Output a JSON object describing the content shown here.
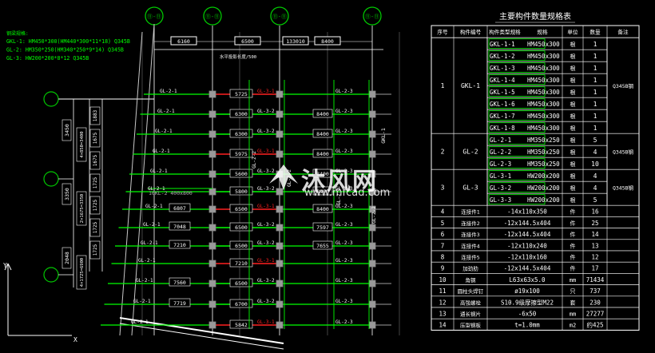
{
  "colors": {
    "background": "#000000",
    "cad_green": "#00ff00",
    "cad_white": "#ffffff",
    "cad_yellow": "#ffff00",
    "cad_red": "#ff2020",
    "cad_cyan": "#00ffff",
    "axis_green": "#00c800"
  },
  "axis_bubbles_top": [
    "⑪-⑪",
    "⑪-⑪",
    "⑪-⑪",
    "⑪-⑪"
  ],
  "dims_top": [
    "6160",
    "6500",
    "133010",
    "8400"
  ],
  "legend": {
    "heading": "钢梁规格:",
    "lines": [
      "GKL-1: HM450*300(HM440*300*11*18)    Q345B",
      "GL-2: HM350*250(HM340*250*9*14)   Q345B",
      "GL-3: HW200*200*8*12    Q345B"
    ]
  },
  "row_dims": [
    "5725",
    "6300",
    "6300",
    "5975",
    "5600",
    "5800",
    "6500",
    "6500",
    "6500",
    "7210",
    "6500",
    "6700",
    "5842"
  ],
  "right_dims": [
    "8400",
    "8400",
    "8400",
    "8400",
    "8400",
    "8400",
    "7597",
    "7655"
  ],
  "left_dims": [
    "7560",
    "7719",
    "6807",
    "7048",
    "7210"
  ],
  "beam_labels": {
    "gl3": "GL-3-1",
    "gl2": "GL-2-3",
    "gl2b": "GL-2-1",
    "gl3b": "GL-3-2",
    "gl2c": "GL-2-2",
    "gkl": "GKL-1"
  },
  "left_col_dims": [
    "1883",
    "1675",
    "1675",
    "1725",
    "1725",
    "1725",
    "1725"
  ],
  "left_big_dims": [
    "3450",
    "3350",
    "2048"
  ],
  "left_span_dims": [
    "4×850=3400",
    "2×1675=3350",
    "4×1725=6900"
  ],
  "misc_text": {
    "gkl_block": "10KL-2  400x800",
    "slope_note": "水平投影长度/500",
    "x_axis": "X",
    "y_axis": "Y"
  },
  "table": {
    "title": "主要构件数量规格表",
    "headers": [
      "序号",
      "构件编号",
      "构件类型规格",
      "规格",
      "单位",
      "数量",
      "备注"
    ],
    "groups": [
      {
        "no": "1",
        "name": "GKL-1",
        "note": "Q345B钢",
        "rows": [
          {
            "code": "GKL-1-1",
            "spec": "HM450x300",
            "unit": "根",
            "qty": "1"
          },
          {
            "code": "GKL-1-2",
            "spec": "HM450x300",
            "unit": "根",
            "qty": "1"
          },
          {
            "code": "GKL-1-3",
            "spec": "HM450x300",
            "unit": "根",
            "qty": "1"
          },
          {
            "code": "GKL-1-4",
            "spec": "HM450x300",
            "unit": "根",
            "qty": "1"
          },
          {
            "code": "GKL-1-5",
            "spec": "HM450x300",
            "unit": "根",
            "qty": "1"
          },
          {
            "code": "GKL-1-6",
            "spec": "HM450x300",
            "unit": "根",
            "qty": "1"
          },
          {
            "code": "GKL-1-7",
            "spec": "HM450x300",
            "unit": "根",
            "qty": "1"
          },
          {
            "code": "GKL-1-8",
            "spec": "HM450x300",
            "unit": "根",
            "qty": "1"
          }
        ]
      },
      {
        "no": "2",
        "name": "GL-2",
        "note": "Q345B钢",
        "rows": [
          {
            "code": "GL-2-1",
            "spec": "HM350x250",
            "unit": "根",
            "qty": "5"
          },
          {
            "code": "GL-2-2",
            "spec": "HM350x250",
            "unit": "根",
            "qty": "4"
          },
          {
            "code": "GL-2-3",
            "spec": "HM350x250",
            "unit": "根",
            "qty": "10"
          }
        ]
      },
      {
        "no": "3",
        "name": "GL-3",
        "note": "Q345B钢",
        "rows": [
          {
            "code": "GL-3-1",
            "spec": "HW200x200",
            "unit": "根",
            "qty": "4"
          },
          {
            "code": "GL-3-2",
            "spec": "HW200x200",
            "unit": "根",
            "qty": "4"
          },
          {
            "code": "GL-3-3",
            "spec": "HW200x200",
            "unit": "根",
            "qty": "5"
          }
        ]
      }
    ],
    "extra_rows": [
      {
        "no": "4",
        "name": "连接件1",
        "spec": "-14x110x350",
        "unit": "件",
        "qty": "16"
      },
      {
        "no": "5",
        "name": "连接件2",
        "spec": "-12x144.5x404",
        "unit": "件",
        "qty": "25"
      },
      {
        "no": "6",
        "name": "连接件3",
        "spec": "-12x144.5x404",
        "unit": "件",
        "qty": "14"
      },
      {
        "no": "7",
        "name": "连接件4",
        "spec": "-12x110x240",
        "unit": "件",
        "qty": "13"
      },
      {
        "no": "8",
        "name": "连接件5",
        "spec": "-12x110x160",
        "unit": "件",
        "qty": "12"
      },
      {
        "no": "9",
        "name": "加劲肋",
        "spec": "-12x144.5x404",
        "unit": "件",
        "qty": "17"
      },
      {
        "no": "10",
        "name": "角钢",
        "spec": "L63x63x5.0",
        "unit": "mm",
        "qty": "71434"
      },
      {
        "no": "11",
        "name": "圆柱头焊钉",
        "spec": "ø19x100",
        "unit": "只",
        "qty": "737"
      },
      {
        "no": "12",
        "name": "高强螺栓",
        "spec": "S10.9级摩擦型M22",
        "unit": "套",
        "qty": "230"
      },
      {
        "no": "13",
        "name": "通长钢片",
        "spec": "-6x50",
        "unit": "mm",
        "qty": "27277"
      },
      {
        "no": "14",
        "name": "压型钢板",
        "spec": "t=1.0mm",
        "unit": "m2",
        "qty": "约425"
      }
    ]
  },
  "watermark": {
    "title": "沐风网",
    "url": "www.mfcad.com"
  }
}
